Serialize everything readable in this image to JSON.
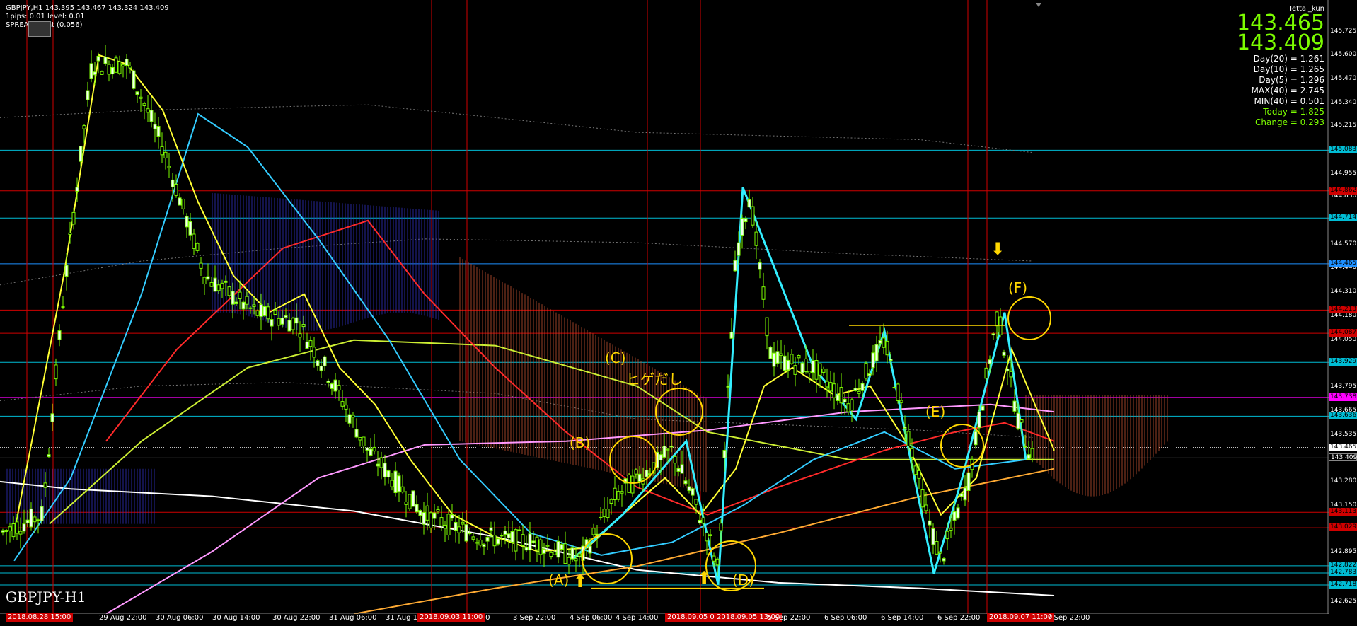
{
  "header": {
    "symbol_line": "GBPJPY,H1  143.395 143.467 143.324 143.409",
    "pips_line": "1pips: 0.01   level: 0.01",
    "spread_line": "SPREAD   point (0.056)"
  },
  "account_name": "Tettai_kun",
  "prices": {
    "ask": "143.465",
    "bid": "143.409"
  },
  "stats": [
    {
      "text": "Day(20) = 1.261",
      "color": "#ffffff"
    },
    {
      "text": "Day(10) = 1.265",
      "color": "#ffffff"
    },
    {
      "text": "Day(5) = 1.296",
      "color": "#ffffff"
    },
    {
      "text": "MAX(40) = 2.745",
      "color": "#ffffff"
    },
    {
      "text": "MIN(40) = 0.501",
      "color": "#ffffff"
    },
    {
      "text": "Today = 1.825",
      "color": "#7cfc00"
    },
    {
      "text": "Change = 0.293",
      "color": "#7cfc00"
    }
  ],
  "price_axis": [
    "145.725",
    "145.600",
    "145.470",
    "145.340",
    "145.215",
    "144.955",
    "144.830",
    "144.700",
    "144.570",
    "144.440",
    "144.310",
    "144.180",
    "144.050",
    "143.795",
    "143.665",
    "143.535",
    "143.280",
    "143.150",
    "143.025",
    "142.895",
    "142.625"
  ],
  "price_tags": [
    {
      "label": "145.083",
      "bg": "#00bcd4",
      "fg": "#000000"
    },
    {
      "label": "144.862",
      "bg": "#d00000",
      "fg": "#000000"
    },
    {
      "label": "144.714",
      "bg": "#00bcd4",
      "fg": "#000000"
    },
    {
      "label": "144.465",
      "bg": "#1e90ff",
      "fg": "#000000"
    },
    {
      "label": "144.213",
      "bg": "#d00000",
      "fg": "#000000"
    },
    {
      "label": "144.087",
      "bg": "#d00000",
      "fg": "#000000"
    },
    {
      "label": "143.929",
      "bg": "#00bcd4",
      "fg": "#000000"
    },
    {
      "label": "143.738",
      "bg": "#ff00ff",
      "fg": "#000000"
    },
    {
      "label": "143.636",
      "bg": "#00bcd4",
      "fg": "#000000"
    },
    {
      "label": "143.465",
      "bg": "#ffffff",
      "fg": "#000000"
    },
    {
      "label": "143.409",
      "bg": "#000000",
      "fg": "#ffffff"
    },
    {
      "label": "143.113",
      "bg": "#d00000",
      "fg": "#000000"
    },
    {
      "label": "143.029",
      "bg": "#d00000",
      "fg": "#000000"
    },
    {
      "label": "142.822",
      "bg": "#00bcd4",
      "fg": "#000000"
    },
    {
      "label": "142.783",
      "bg": "#00bcd4",
      "fg": "#000000"
    },
    {
      "label": "142.718",
      "bg": "#00bcd4",
      "fg": "#000000"
    }
  ],
  "time_axis": [
    {
      "label": "2018.08.28 15:00",
      "highlight": true
    },
    {
      "label": "29 Aug 22:00",
      "highlight": false
    },
    {
      "label": "30 Aug 06:00",
      "highlight": false
    },
    {
      "label": "30 Aug 14:00",
      "highlight": false
    },
    {
      "label": "30 Aug 22:00",
      "highlight": false
    },
    {
      "label": "31 Aug 06:00",
      "highlight": false
    },
    {
      "label": "31 Aug 14:00",
      "highlight": false
    },
    {
      "label": "31 Aug 22:00",
      "highlight": false
    },
    {
      "label": "2018.09.03 11:00",
      "highlight": true
    },
    {
      "label": "3 Sep 22:00",
      "highlight": false
    },
    {
      "label": "4 Sep 06:00",
      "highlight": false
    },
    {
      "label": "4 Sep 14:00",
      "highlight": false
    },
    {
      "label": "2018.09.05 01:00",
      "highlight": true
    },
    {
      "label": "2018.09.05 13:00",
      "highlight": true
    },
    {
      "label": "5 Sep 22:00",
      "highlight": false
    },
    {
      "label": "6 Sep 06:00",
      "highlight": false
    },
    {
      "label": "6 Sep 14:00",
      "highlight": false
    },
    {
      "label": "6 Sep 22:00",
      "highlight": false
    },
    {
      "label": "2018.09.07 11:00",
      "highlight": true
    },
    {
      "label": "7 Sep 22:00",
      "highlight": false
    }
  ],
  "annotations": {
    "a": "(A)",
    "b": "(B)",
    "c": "(C)",
    "d": "(D)",
    "e": "(E)",
    "f": "(F)",
    "hige": "ヒゲだし"
  },
  "symbol_label": "GBPJPY-H1",
  "colors": {
    "background": "#000000",
    "candle": "#7cfc00",
    "ma_yellow": "#ffff33",
    "ma_cyan": "#33ccff",
    "ma_red": "#ff2a2a",
    "ma_white": "#ffffff",
    "ma_pink": "#ff99ff",
    "annotation": "#ffd700"
  }
}
